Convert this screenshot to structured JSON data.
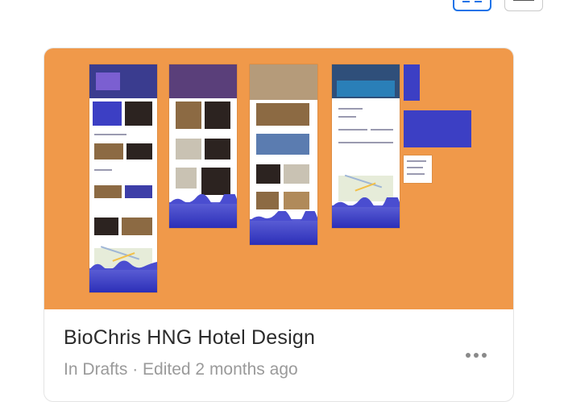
{
  "toolbar": {
    "grid_view": {
      "icon": "grid-icon",
      "state": "active",
      "accent": "#1a73e8"
    },
    "list_view": {
      "icon": "list-icon",
      "state": "inactive"
    }
  },
  "project": {
    "title": "BioChris HNG Hotel Design",
    "location": "In Drafts",
    "separator": "·",
    "edited": "Edited 2 months ago",
    "thumbnail_bg": "#f0994a",
    "more_icon": "more-horizontal-icon"
  }
}
